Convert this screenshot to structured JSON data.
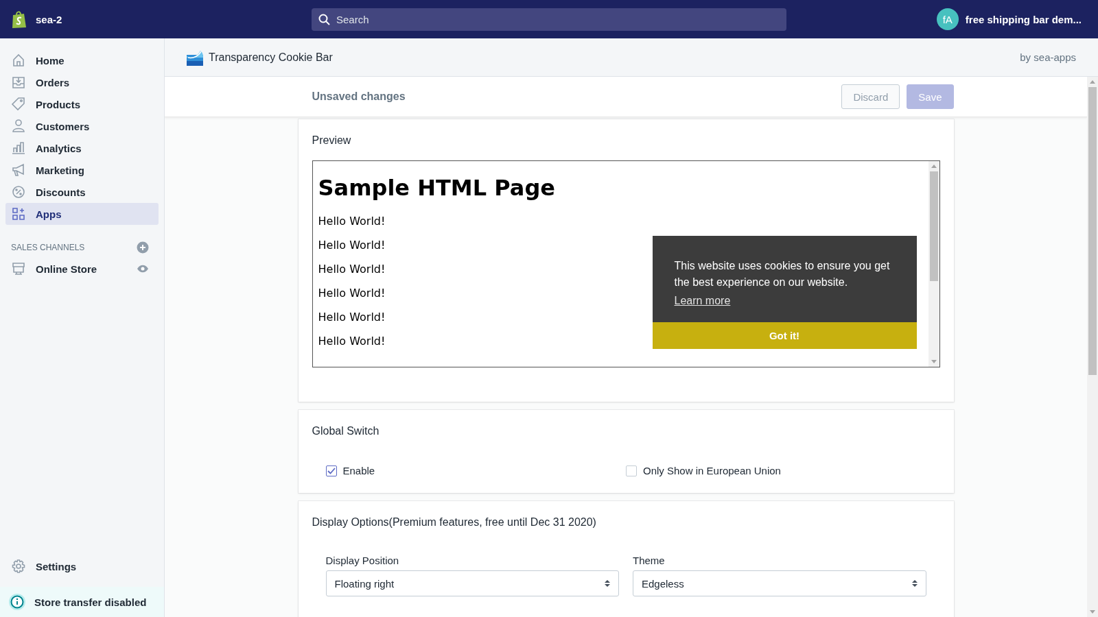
{
  "topbar": {
    "store_name": "sea-2",
    "search": {
      "placeholder": "Search"
    },
    "account": {
      "initials": "fA",
      "name": "free shipping bar dem..."
    }
  },
  "sidebar": {
    "items": [
      {
        "label": "Home",
        "kind": "home",
        "selected": false
      },
      {
        "label": "Orders",
        "kind": "orders",
        "selected": false
      },
      {
        "label": "Products",
        "kind": "tag",
        "selected": false
      },
      {
        "label": "Customers",
        "kind": "person",
        "selected": false
      },
      {
        "label": "Analytics",
        "kind": "chart",
        "selected": false
      },
      {
        "label": "Marketing",
        "kind": "megaphone",
        "selected": false
      },
      {
        "label": "Discounts",
        "kind": "discount",
        "selected": false
      },
      {
        "label": "Apps",
        "kind": "apps",
        "selected": true
      }
    ],
    "sales_channels": {
      "heading": "SALES CHANNELS",
      "items": [
        {
          "label": "Online Store"
        }
      ]
    },
    "settings": "Settings",
    "notice": "Store transfer disabled"
  },
  "app_header": {
    "title": "Transparency Cookie Bar",
    "byline": "by sea-apps"
  },
  "save_bar": {
    "message": "Unsaved changes",
    "buttons": [
      {
        "label": "Discard",
        "kind": "secondary"
      },
      {
        "label": "Save",
        "kind": "primary"
      }
    ]
  },
  "preview": {
    "title": "Preview",
    "page_heading": "Sample HTML Page",
    "lines": [
      "Hello World!",
      "Hello World!",
      "Hello World!",
      "Hello World!",
      "Hello World!",
      "Hello World!"
    ],
    "cookie_popup": {
      "message": "This website uses cookies to ensure you get the best experience on our website.",
      "link": "Learn more",
      "button": "Got it!"
    }
  },
  "global_switch": {
    "title": "Global Switch",
    "options": [
      {
        "label": "Enable",
        "checked": true
      },
      {
        "label": "Only Show in European Union",
        "checked": false
      }
    ]
  },
  "display_options": {
    "title": "Display Options(Premium features, free until Dec 31 2020)",
    "fields": [
      {
        "label": "Display Position",
        "value": "Floating right"
      },
      {
        "label": "Theme",
        "value": "Edgeless"
      }
    ]
  }
}
